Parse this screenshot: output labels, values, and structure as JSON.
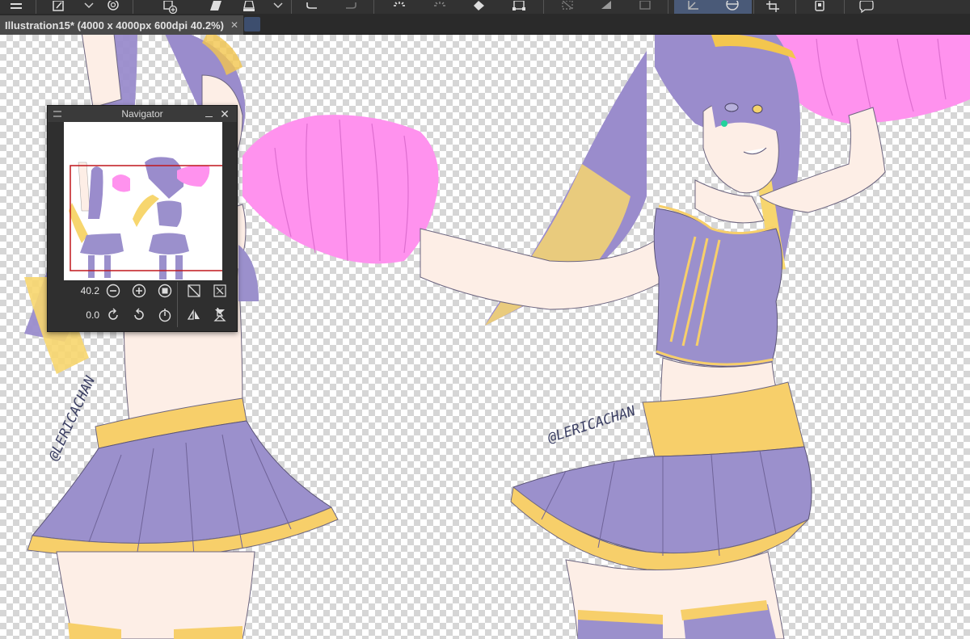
{
  "toolbar": {
    "icons": [
      "menu-icon",
      "new-layer-icon",
      "pen-icon",
      "dropdown-icon",
      "stamp-icon",
      "add-icon",
      "fill-icon",
      "tone-icon",
      "undo-icon",
      "redo-icon",
      "loading-icon",
      "sparkle-icon",
      "fill-bucket-icon",
      "transform-icon",
      "clear-icon",
      "fill-selection-icon",
      "frame-icon",
      "rotate-canvas-icon",
      "flip-icon",
      "crop-icon",
      "device-icon",
      "comment-icon"
    ]
  },
  "document": {
    "tab_title": "Illustration15* (4000 x 4000px 600dpi 40.2%)"
  },
  "canvas": {
    "watermark_left": "@LERICACHAN",
    "watermark_right": "@LERICACHAN",
    "colors": {
      "skin": "#fdeee6",
      "outfit": "#9b90cc",
      "trim": "#f7cf6a",
      "hair": "#9a8ccc",
      "pompom": "#ff92ee",
      "line": "#5b5476"
    }
  },
  "navigator": {
    "title": "Navigator",
    "zoom_value": "40.2",
    "rotation_value": "0.0",
    "icons": [
      "zoom-out-icon",
      "zoom-in-icon",
      "actual-size-icon",
      "fit-to-window-icon",
      "fit-icon",
      "rotate-left-icon",
      "rotate-right-icon",
      "reset-rotation-icon",
      "flip-horizontal-icon",
      "flip-vertical-icon"
    ]
  }
}
